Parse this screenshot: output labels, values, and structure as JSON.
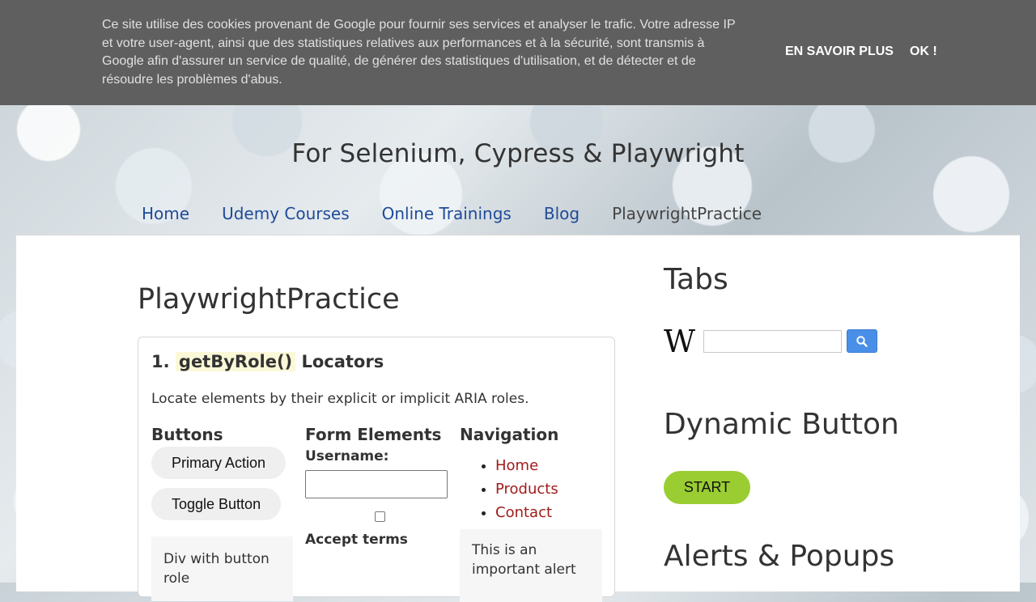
{
  "cookie_bar": {
    "text": "Ce site utilise des cookies provenant de Google pour fournir ses services et analyser le trafic. Votre adresse IP et votre user-agent, ainsi que des statistiques relatives aux performances et à la sécurité, sont transmis à Google afin d'assurer un service de qualité, de générer des statistiques d'utilisation, et de détecter et de résoudre les problèmes d'abus.",
    "learn_more": "EN SAVOIR PLUS",
    "ok": "OK !"
  },
  "header": {
    "description": "For Selenium, Cypress & Playwright",
    "nav": [
      {
        "label": "Home"
      },
      {
        "label": "Udemy Courses"
      },
      {
        "label": "Online Trainings"
      },
      {
        "label": "Blog"
      },
      {
        "label": "PlaywrightPractice"
      }
    ]
  },
  "main": {
    "title": "PlaywrightPractice",
    "section": {
      "number": "1.",
      "code": "getByRole()",
      "heading_suffix": "Locators",
      "description": "Locate elements by their explicit or implicit ARIA roles.",
      "buttons_title": "Buttons",
      "primary_action": "Primary Action",
      "toggle_button": "Toggle Button",
      "div_button": "Div with button role",
      "form_title": "Form Elements",
      "username_label": "Username:",
      "username_value": "",
      "accept_terms": "Accept terms",
      "navigation_title": "Navigation",
      "nav_links": [
        {
          "label": "Home"
        },
        {
          "label": "Products"
        },
        {
          "label": "Contact"
        }
      ],
      "alert_text": "This is an important alert"
    }
  },
  "sidebar": {
    "tabs_title": "Tabs",
    "wiki_logo": "W",
    "dynamic_button_title": "Dynamic Button",
    "start_label": "START",
    "alerts_title": "Alerts & Popups"
  },
  "colors": {
    "cookie_bar_bg": "#5f5f5f",
    "nav_link": "#1f4b99",
    "list_link": "#a11c1c",
    "start_button": "#9acd32",
    "search_button": "#4a8fe7",
    "code_highlight": "#fbf8d8"
  }
}
